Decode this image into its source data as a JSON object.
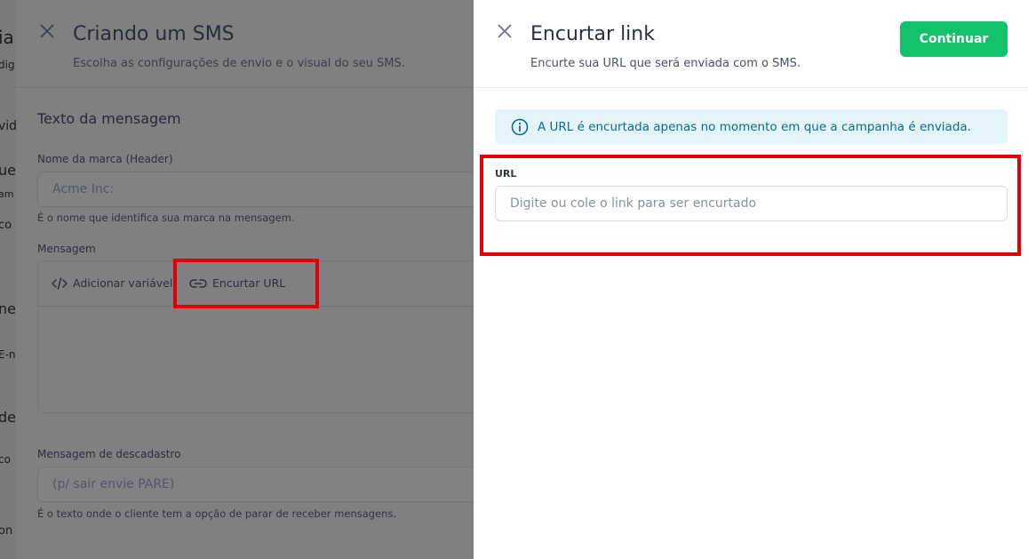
{
  "background_page": {
    "fragments": [
      "ia",
      "dig",
      "vid",
      "ue",
      "am",
      "co",
      "ne",
      "E-n",
      "de",
      "co",
      "on"
    ]
  },
  "modal": {
    "title": "Criando um SMS",
    "subtitle": "Escolha as configurações de envio e o visual do seu SMS.",
    "section_title": "Texto da mensagem",
    "brand_label": "Nome da marca (Header)",
    "brand_value": "Acme Inc:",
    "brand_help": "É o nome que identifica sua marca na mensagem.",
    "message_label": "Mensagem",
    "toolbar": {
      "add_variable": "Adicionar variável",
      "shorten_url": "Encurtar URL"
    },
    "unsubscribe_label": "Mensagem de descadastro",
    "unsubscribe_value": "(p/ sair envie PARE)",
    "unsubscribe_help": "É o texto onde o cliente tem a opção de parar de receber mensagens."
  },
  "drawer": {
    "title": "Encurtar link",
    "subtitle": "Encurte sua URL que será enviada com o SMS.",
    "continue_label": "Continuar",
    "info_text": "A URL é encurtada apenas no momento em que a campanha é enviada.",
    "url_label": "URL",
    "url_placeholder": "Digite ou cole o link para ser encurtado",
    "url_value": ""
  },
  "colors": {
    "accent_green": "#13c16a",
    "info_bg": "#e3f5fa",
    "info_text": "#0d6c86",
    "highlight_red": "#e10000",
    "overlay": "#6f6f6f"
  },
  "icons": {
    "close": "close-icon",
    "info": "info-icon",
    "code": "code-icon",
    "link": "link-icon"
  }
}
